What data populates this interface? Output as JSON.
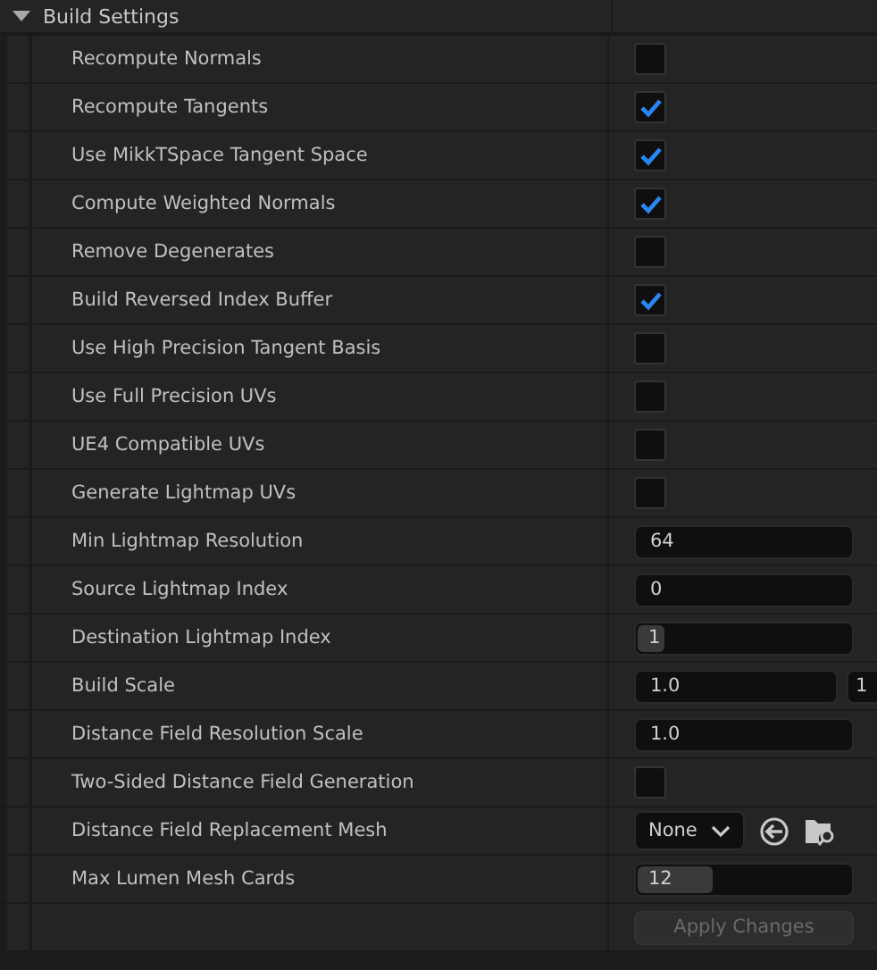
{
  "section": {
    "title": "Build Settings",
    "expanded": true
  },
  "rows": [
    {
      "label": "Recompute Normals",
      "kind": "checkbox",
      "checked": false
    },
    {
      "label": "Recompute Tangents",
      "kind": "checkbox",
      "checked": true
    },
    {
      "label": "Use MikkTSpace Tangent Space",
      "kind": "checkbox",
      "checked": true
    },
    {
      "label": "Compute Weighted Normals",
      "kind": "checkbox",
      "checked": true
    },
    {
      "label": "Remove Degenerates",
      "kind": "checkbox",
      "checked": false
    },
    {
      "label": "Build Reversed Index Buffer",
      "kind": "checkbox",
      "checked": true
    },
    {
      "label": "Use High Precision Tangent Basis",
      "kind": "checkbox",
      "checked": false
    },
    {
      "label": "Use Full Precision UVs",
      "kind": "checkbox",
      "checked": false
    },
    {
      "label": "UE4 Compatible UVs",
      "kind": "checkbox",
      "checked": false
    },
    {
      "label": "Generate Lightmap UVs",
      "kind": "checkbox",
      "checked": false
    },
    {
      "label": "Min Lightmap Resolution",
      "kind": "number",
      "value": "64"
    },
    {
      "label": "Source Lightmap Index",
      "kind": "number",
      "value": "0"
    },
    {
      "label": "Destination Lightmap Index",
      "kind": "slider",
      "value": "1",
      "level": 0.05
    },
    {
      "label": "Build Scale",
      "kind": "vector",
      "values": [
        "1.0",
        "1"
      ]
    },
    {
      "label": "Distance Field Resolution Scale",
      "kind": "number",
      "value": "1.0"
    },
    {
      "label": "Two-Sided Distance Field Generation",
      "kind": "checkbox",
      "checked": false
    },
    {
      "label": "Distance Field Replacement Mesh",
      "kind": "asset",
      "value": "None"
    },
    {
      "label": "Max Lumen Mesh Cards",
      "kind": "slider",
      "value": "12",
      "level": 0.35
    }
  ],
  "apply_button": {
    "label": "Apply Changes",
    "disabled": true
  }
}
